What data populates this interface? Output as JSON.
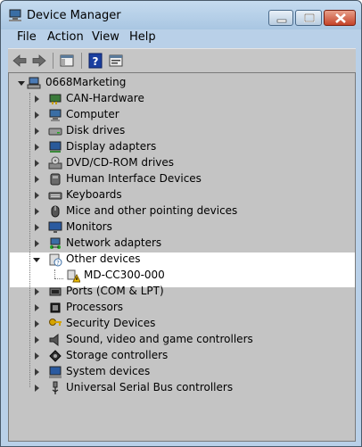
{
  "window": {
    "title": "Device Manager"
  },
  "menu": [
    "File",
    "Action",
    "View",
    "Help"
  ],
  "tree": {
    "root": "0668Marketing",
    "categories": [
      {
        "label": "CAN-Hardware",
        "icon": "network-card-icon"
      },
      {
        "label": "Computer",
        "icon": "computer-icon"
      },
      {
        "label": "Disk drives",
        "icon": "disk-drive-icon"
      },
      {
        "label": "Display adapters",
        "icon": "display-adapter-icon"
      },
      {
        "label": "DVD/CD-ROM drives",
        "icon": "dvd-drive-icon"
      },
      {
        "label": "Human Interface Devices",
        "icon": "hid-icon"
      },
      {
        "label": "Keyboards",
        "icon": "keyboard-icon"
      },
      {
        "label": "Mice and other pointing devices",
        "icon": "mouse-icon"
      },
      {
        "label": "Monitors",
        "icon": "monitor-icon"
      },
      {
        "label": "Network adapters",
        "icon": "network-adapter-icon"
      },
      {
        "label": "Other devices",
        "icon": "other-devices-icon",
        "expanded": true
      },
      {
        "label": "Ports (COM & LPT)",
        "icon": "port-icon"
      },
      {
        "label": "Processors",
        "icon": "processor-icon"
      },
      {
        "label": "Security Devices",
        "icon": "security-key-icon"
      },
      {
        "label": "Sound, video and game controllers",
        "icon": "speaker-icon"
      },
      {
        "label": "Storage controllers",
        "icon": "storage-controller-icon"
      },
      {
        "label": "System devices",
        "icon": "system-devices-icon"
      },
      {
        "label": "Universal Serial Bus controllers",
        "icon": "usb-icon"
      }
    ],
    "other_devices_children": [
      {
        "label": "MD-CC300-000",
        "icon": "warning-device-icon"
      }
    ]
  }
}
